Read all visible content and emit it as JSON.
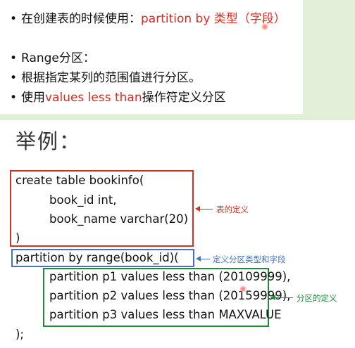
{
  "bullets": [
    {
      "prefix": "在创建表的时候使用：",
      "highlight": "partition by  类型（字段）",
      "suffix": ""
    },
    {
      "prefix": "Range分区：",
      "highlight": "",
      "suffix": ""
    },
    {
      "prefix": "根据指定某列的范围值进行分区。",
      "highlight": "",
      "suffix": ""
    },
    {
      "prefix": "使用",
      "highlight": "values  less  than",
      "suffix": "操作符定义分区"
    }
  ],
  "bullet_symbol": "•",
  "example_title": "举例：",
  "code": {
    "line1": "create table bookinfo(",
    "line2": "book_id int,",
    "line3": "book_name  varchar(20)",
    "line4": ")",
    "line5": "partition by range(book_id)(",
    "line6": "partition p1 values less than (20109999),",
    "line7": "partition p2 values less than (20159999),",
    "line8": "partition p3 values less than MAXVALUE",
    "line9": ");"
  },
  "annotations": {
    "table_def": "表的定义",
    "partition_type": "定义分区类型和字段",
    "partition_def": "分区的定义"
  },
  "colors": {
    "highlight_red": "#e0281f",
    "table_box": "#d2321f",
    "partition_box": "#4472c4",
    "defs_box": "#1e8c3a",
    "background": "#e2efd9"
  }
}
